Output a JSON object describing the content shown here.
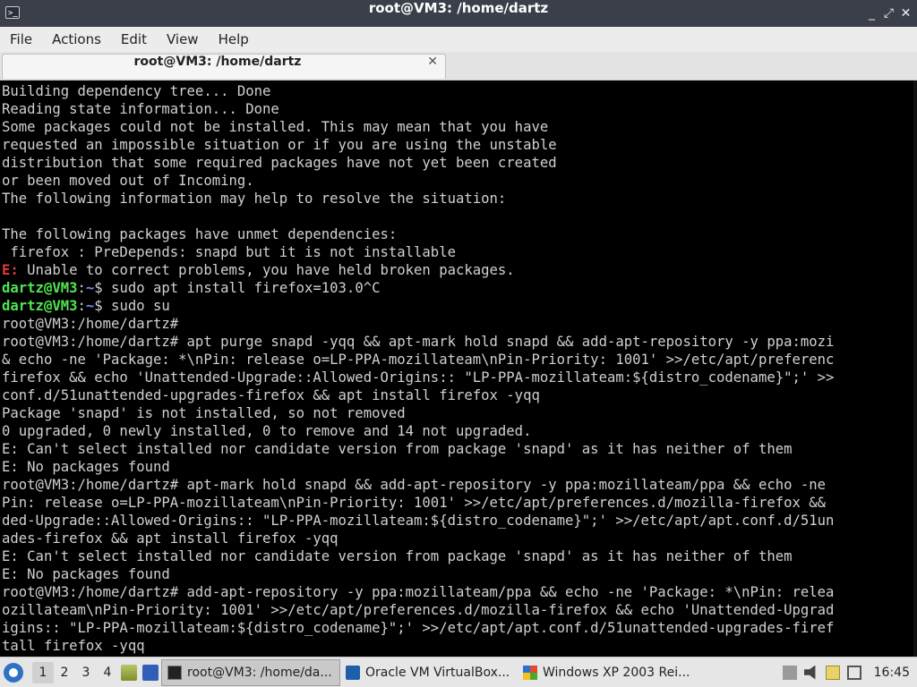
{
  "window": {
    "title": "root@VM3: /home/dartz",
    "app_icon_glyph": ">_",
    "minimize_glyph": "_",
    "maximize_glyph": "⤢",
    "close_glyph": "✕"
  },
  "menu": {
    "items": [
      "File",
      "Actions",
      "Edit",
      "View",
      "Help"
    ]
  },
  "tab": {
    "label": "root@VM3: /home/dartz",
    "close_glyph": "✕"
  },
  "terminal": {
    "colors": {
      "background": "#000000",
      "text": "#d0d0d0",
      "user_host": "#4fe64f",
      "path": "#6e8ff3",
      "error": "#e03a3a"
    },
    "lines": [
      [
        {
          "t": "Building dependency tree... Done"
        }
      ],
      [
        {
          "t": "Reading state information... Done"
        }
      ],
      [
        {
          "t": "Some packages could not be installed. This may mean that you have"
        }
      ],
      [
        {
          "t": "requested an impossible situation or if you are using the unstable"
        }
      ],
      [
        {
          "t": "distribution that some required packages have not yet been created"
        }
      ],
      [
        {
          "t": "or been moved out of Incoming."
        }
      ],
      [
        {
          "t": "The following information may help to resolve the situation:"
        }
      ],
      [
        {
          "t": ""
        }
      ],
      [
        {
          "t": "The following packages have unmet dependencies:"
        }
      ],
      [
        {
          "t": " firefox : PreDepends: snapd but it is not installable"
        }
      ],
      [
        {
          "t": "E:",
          "c": "r"
        },
        {
          "t": " Unable to correct problems, you have held broken packages."
        }
      ],
      [
        {
          "t": "dartz@VM3",
          "c": "g"
        },
        {
          "t": ":"
        },
        {
          "t": "~",
          "c": "b"
        },
        {
          "t": "$ sudo apt install firefox=103.0^C"
        }
      ],
      [
        {
          "t": "dartz@VM3",
          "c": "g"
        },
        {
          "t": ":"
        },
        {
          "t": "~",
          "c": "b"
        },
        {
          "t": "$ sudo su"
        }
      ],
      [
        {
          "t": "root@VM3:/home/dartz#"
        }
      ],
      [
        {
          "t": "root@VM3:/home/dartz# apt purge snapd -yqq && apt-mark hold snapd && add-apt-repository -y ppa:mozi"
        }
      ],
      [
        {
          "t": "& echo -ne 'Package: *\\nPin: release o=LP-PPA-mozillateam\\nPin-Priority: 1001' >>/etc/apt/preferenc"
        }
      ],
      [
        {
          "t": "firefox && echo 'Unattended-Upgrade::Allowed-Origins:: \"LP-PPA-mozillateam:${distro_codename}\";' >>"
        }
      ],
      [
        {
          "t": "conf.d/51unattended-upgrades-firefox && apt install firefox -yqq"
        }
      ],
      [
        {
          "t": "Package 'snapd' is not installed, so not removed"
        }
      ],
      [
        {
          "t": "0 upgraded, 0 newly installed, 0 to remove and 14 not upgraded."
        }
      ],
      [
        {
          "t": "E: Can't select installed nor candidate version from package 'snapd' as it has neither of them"
        }
      ],
      [
        {
          "t": "E: No packages found"
        }
      ],
      [
        {
          "t": "root@VM3:/home/dartz# apt-mark hold snapd && add-apt-repository -y ppa:mozillateam/ppa && echo -ne"
        }
      ],
      [
        {
          "t": "Pin: release o=LP-PPA-mozillateam\\nPin-Priority: 1001' >>/etc/apt/preferences.d/mozilla-firefox &&"
        }
      ],
      [
        {
          "t": "ded-Upgrade::Allowed-Origins:: \"LP-PPA-mozillateam:${distro_codename}\";' >>/etc/apt/apt.conf.d/51un"
        }
      ],
      [
        {
          "t": "ades-firefox && apt install firefox -yqq"
        }
      ],
      [
        {
          "t": "E: Can't select installed nor candidate version from package 'snapd' as it has neither of them"
        }
      ],
      [
        {
          "t": "E: No packages found"
        }
      ],
      [
        {
          "t": "root@VM3:/home/dartz# add-apt-repository -y ppa:mozillateam/ppa && echo -ne 'Package: *\\nPin: relea"
        }
      ],
      [
        {
          "t": "ozillateam\\nPin-Priority: 1001' >>/etc/apt/preferences.d/mozilla-firefox && echo 'Unattended-Upgrad"
        }
      ],
      [
        {
          "t": "igins:: \"LP-PPA-mozillateam:${distro_codename}\";' >>/etc/apt/apt.conf.d/51unattended-upgrades-firef"
        }
      ],
      [
        {
          "t": "tall firefox -yqq"
        }
      ]
    ]
  },
  "taskbar": {
    "workspaces": [
      "1",
      "2",
      "3",
      "4"
    ],
    "active_workspace": "1",
    "tasks": [
      {
        "label": "root@VM3: /home/da...",
        "icon": "terminal-icon",
        "active": true
      },
      {
        "label": "Oracle VM VirtualBox...",
        "icon": "virtualbox-icon",
        "active": false
      },
      {
        "label": "Windows XP 2003 Rei...",
        "icon": "windows-xp-icon",
        "active": false
      }
    ],
    "clock": "16:45"
  }
}
